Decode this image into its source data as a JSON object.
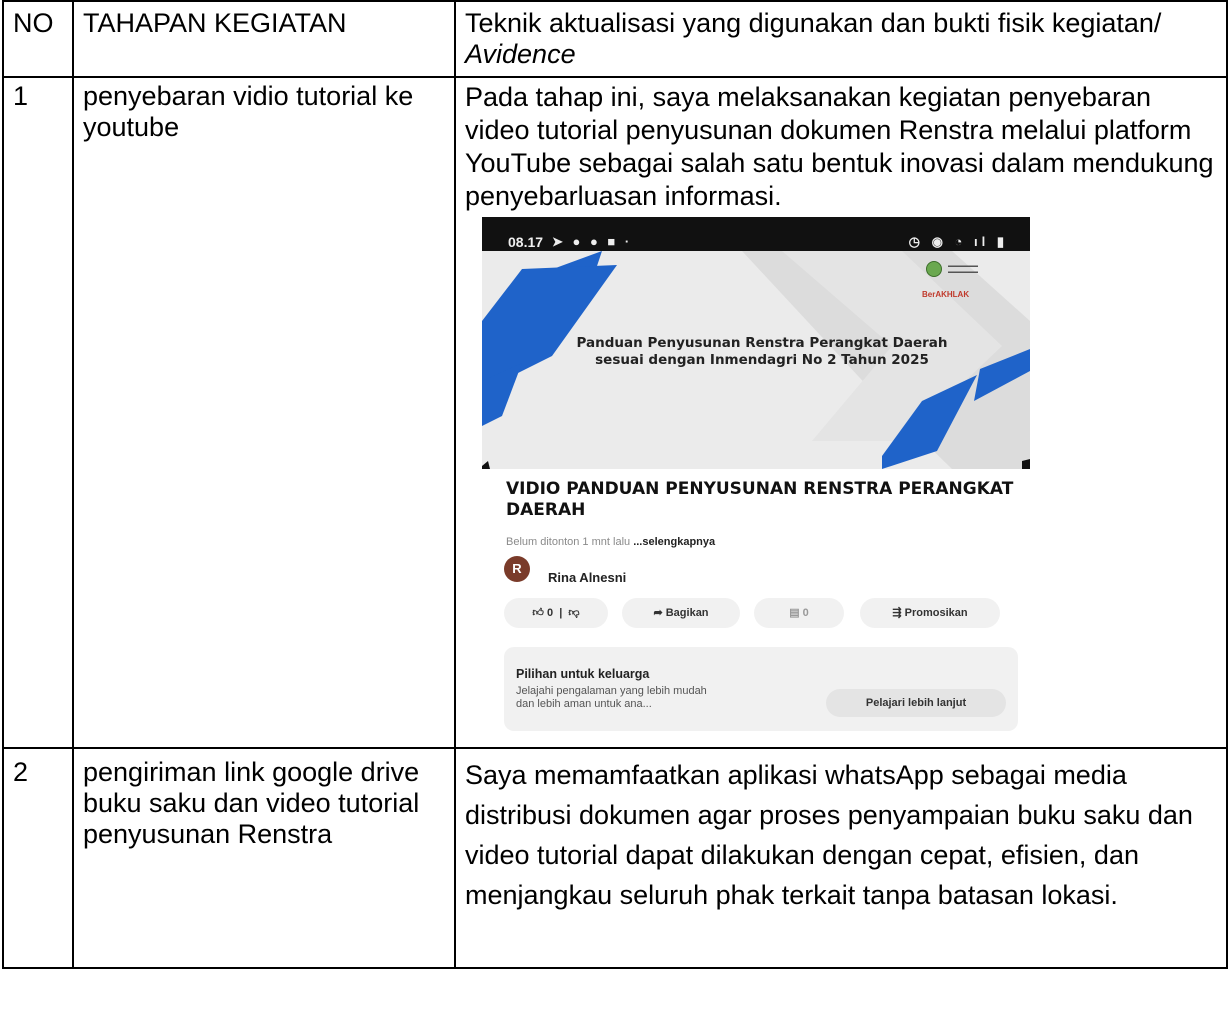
{
  "table": {
    "headers": {
      "no": "NO",
      "stage": "TAHAPAN KEGIATAN",
      "technique_main": "Teknik  aktualisasi yang digunakan dan bukti fisik kegiatan/ ",
      "technique_italic": "Avidence"
    },
    "rows": [
      {
        "no": "1",
        "stage": "penyebaran vidio tutorial ke youtube",
        "description": "Pada tahap ini, saya melaksanakan kegiatan penyebaran video tutorial penyusunan dokumen Renstra melalui platform YouTube sebagai salah satu bentuk inovasi dalam mendukung penyebarluasan informasi."
      },
      {
        "no": "2",
        "stage": "pengiriman link google drive buku saku dan video tutorial penyusunan Renstra",
        "description": "Saya memamfaatkan aplikasi whatsApp sebagai media distribusi dokumen agar proses penyampaian buku saku dan video tutorial dapat dilakukan dengan cepat, efisien, dan menjangkau seluruh phak terkait tanpa batasan lokasi."
      }
    ]
  },
  "evidence": {
    "status_time": "08.17",
    "logo_text": "BerAKHLAK",
    "thumbnail_title": "Panduan  Penyusunan Renstra Perangkat Daerah sesuai dengan Inmendagri No 2 Tahun 2025",
    "video_title": "VIDIO PANDUAN PENYUSUNAN RENSTRA PERANGKAT DAERAH",
    "meta_views": "Belum ditonton  1 mnt lalu  ",
    "meta_more": "...selengkapnya",
    "avatar_letter": "R",
    "author": "Rina Alnesni",
    "like_count": "0",
    "share_label": "Bagikan",
    "comment_count": "0",
    "promote_label": "Promosikan",
    "family_title": "Pilihan untuk keluarga",
    "family_text": "Jelajahi pengalaman yang lebih mudah dan lebih aman untuk ana...",
    "learn_more": "Pelajari lebih lanjut",
    "colors": {
      "accent_blue": "#1f63c9",
      "status_bar": "#111111",
      "avatar": "#7a3b2a"
    }
  }
}
